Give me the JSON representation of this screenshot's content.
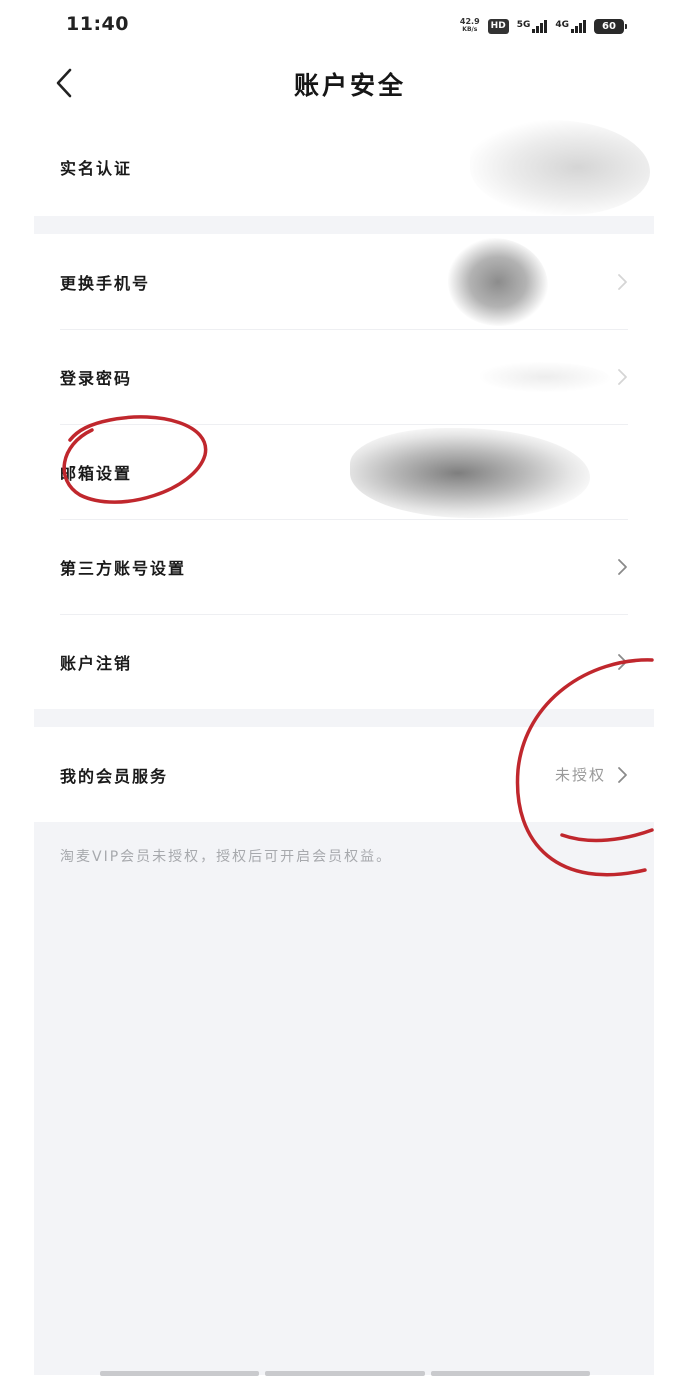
{
  "status_bar": {
    "time": "11:40",
    "net_speed_value": "42.9",
    "net_speed_unit": "KB/s",
    "hd_label": "HD",
    "signal_1_label": "5G",
    "signal_2_label": "4G",
    "battery_level": "60"
  },
  "header": {
    "title": "账户安全",
    "back_icon": "chevron-left-icon"
  },
  "groups": [
    {
      "rows": [
        {
          "label": "实名认证",
          "value": "",
          "value_redacted": true
        }
      ]
    },
    {
      "rows": [
        {
          "label": "更换手机号",
          "value": "",
          "value_redacted": true
        },
        {
          "label": "登录密码",
          "value": "",
          "value_redacted": true
        },
        {
          "label": "邮箱设置",
          "value": "",
          "value_redacted": true
        },
        {
          "label": "第三方账号设置",
          "value": ""
        },
        {
          "label": "账户注销",
          "value": ""
        }
      ]
    },
    {
      "rows": [
        {
          "label": "我的会员服务",
          "value": "未授权"
        }
      ]
    }
  ],
  "footer_note": "淘麦VIP会员未授权，授权后可开启会员权益。",
  "colors": {
    "background": "#ffffff",
    "section_gap": "#f3f4f7",
    "label": "#1a1a1a",
    "secondary_text": "#9a9a9a",
    "footer_text": "#a7a9ad",
    "annotation_ink": "#c0272d"
  }
}
